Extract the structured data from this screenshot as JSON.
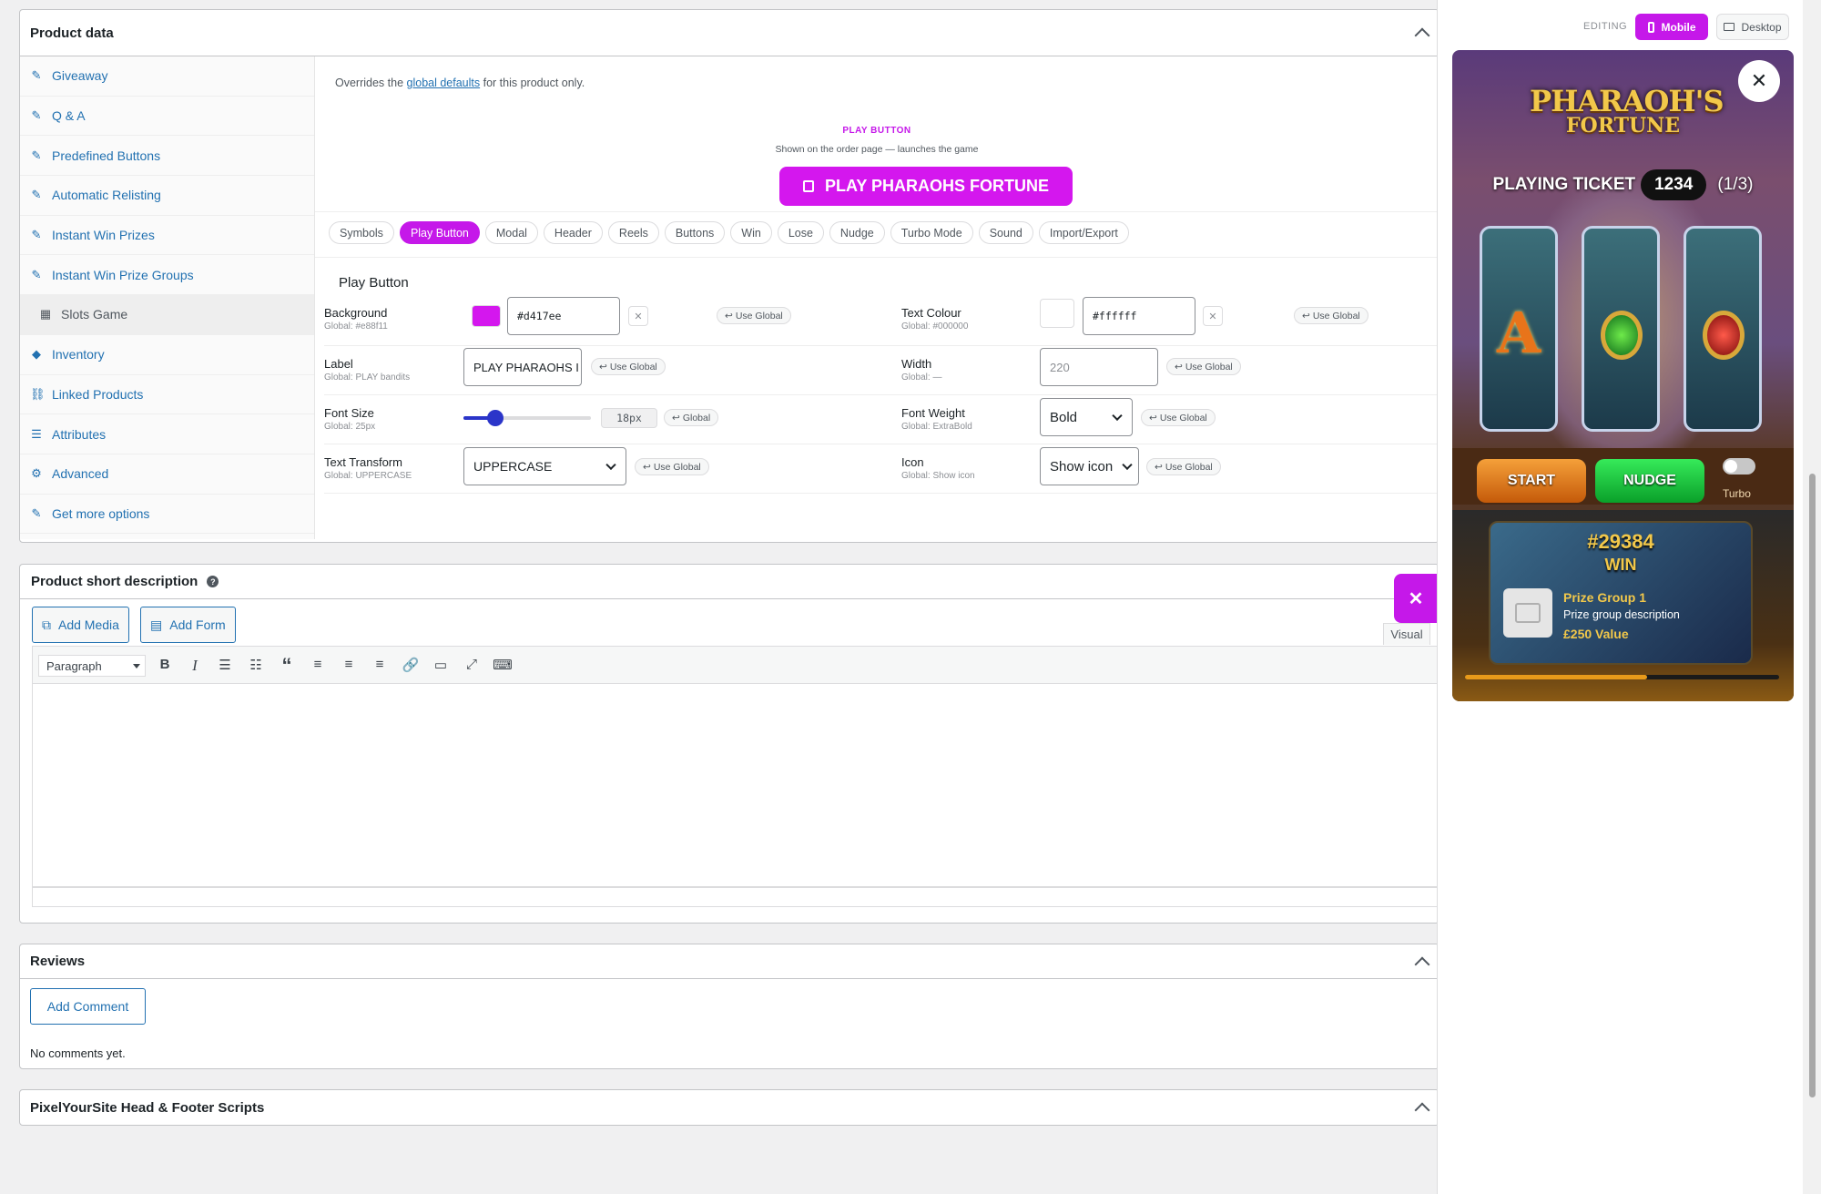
{
  "product_data": {
    "title": "Product data",
    "sidebar": [
      {
        "label": "Giveaway",
        "icon": "wrench-icon"
      },
      {
        "label": "Q & A",
        "icon": "wrench-icon"
      },
      {
        "label": "Predefined Buttons",
        "icon": "wrench-icon"
      },
      {
        "label": "Automatic Relisting",
        "icon": "wrench-icon"
      },
      {
        "label": "Instant Win Prizes",
        "icon": "wrench-icon"
      },
      {
        "label": "Instant Win Prize Groups",
        "icon": "wrench-icon"
      },
      {
        "label": "Slots Game",
        "icon": "slot-machine-icon"
      },
      {
        "label": "Inventory",
        "icon": "tag-icon"
      },
      {
        "label": "Linked Products",
        "icon": "link-icon"
      },
      {
        "label": "Attributes",
        "icon": "list-icon"
      },
      {
        "label": "Advanced",
        "icon": "gear-icon"
      },
      {
        "label": "Get more options",
        "icon": "plugin-icon"
      }
    ],
    "override_prefix": "Overrides the",
    "override_link": "global defaults",
    "override_suffix": "for this product only.",
    "preview_heading": "PLAY BUTTON",
    "preview_sub": "Shown on the order page — launches the game",
    "play_button_label": "PLAY PHARAOHS FORTUNE",
    "tabs": [
      "Symbols",
      "Play Button",
      "Modal",
      "Header",
      "Reels",
      "Buttons",
      "Win",
      "Lose",
      "Nudge",
      "Turbo Mode",
      "Sound",
      "Import/Export"
    ],
    "active_tab": "Play Button",
    "section_title": "Play Button",
    "fields": {
      "background": {
        "label": "Background",
        "global": "Global: #e88f11",
        "value": "#d417ee",
        "use_global": "Use Global",
        "swatch": "#d417ee"
      },
      "text_colour": {
        "label": "Text Colour",
        "global": "Global: #000000",
        "value": "#ffffff",
        "use_global": "Use Global",
        "swatch": "#ffffff"
      },
      "label": {
        "label": "Label",
        "global": "Global: PLAY bandits",
        "value": "PLAY PHARAOHS I",
        "use_global": "Use Global"
      },
      "width": {
        "label": "Width",
        "global": "Global: —",
        "placeholder": "220",
        "use_global": "Use Global"
      },
      "font_size": {
        "label": "Font Size",
        "global": "Global: 25px",
        "value": "18px",
        "use_global": "Global",
        "slider_fraction": 0.25
      },
      "font_weight": {
        "label": "Font Weight",
        "global": "Global: ExtraBold",
        "value": "Bold",
        "use_global": "Use Global"
      },
      "text_transform": {
        "label": "Text Transform",
        "global": "Global: UPPERCASE",
        "value": "UPPERCASE",
        "use_global": "Use Global"
      },
      "icon": {
        "label": "Icon",
        "global": "Global: Show icon",
        "value": "Show icon",
        "use_global": "Use Global"
      }
    }
  },
  "short_description": {
    "title": "Product short description",
    "add_media": "Add Media",
    "add_form": "Add Form",
    "visual_tab": "Visual",
    "paragraph": "Paragraph"
  },
  "reviews": {
    "title": "Reviews",
    "add_comment": "Add Comment",
    "empty": "No comments yet."
  },
  "pixel": {
    "title": "PixelYourSite Head & Footer Scripts"
  },
  "preview_panel": {
    "editing": "EDITING",
    "mobile": "Mobile",
    "desktop": "Desktop",
    "game_title_1": "PHARAOH'S",
    "game_title_2": "FORTUNE",
    "playing_ticket": "PLAYING TICKET",
    "ticket_number": "1234",
    "ticket_count": "(1/3)",
    "start": "START",
    "nudge": "NUDGE",
    "turbo": "Turbo",
    "prize_number": "#29384",
    "win": "WIN",
    "prize_group": "Prize Group 1",
    "prize_desc": "Prize group description",
    "prize_value": "£250 Value",
    "progress_fraction": 0.58
  },
  "colors": {
    "accent": "#c518e9",
    "wp_blue": "#2271b1",
    "start": "#e8821a",
    "nudge": "#16d64c"
  }
}
